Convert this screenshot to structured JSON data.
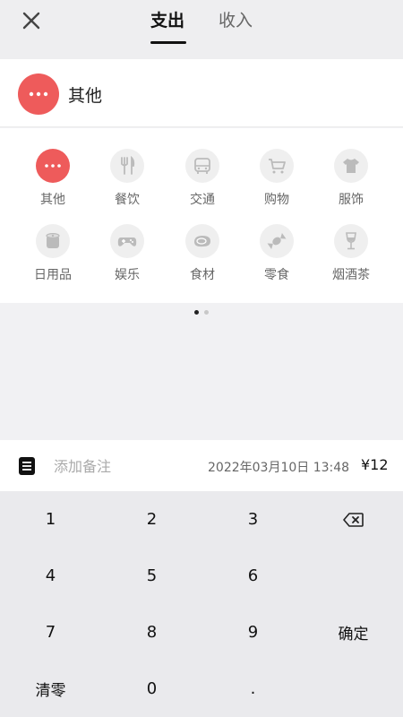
{
  "header": {
    "tabs": [
      {
        "label": "支出",
        "active": true
      },
      {
        "label": "收入",
        "active": false
      }
    ]
  },
  "selected": {
    "label": "其他",
    "color": "#ee5b5b"
  },
  "categories": [
    {
      "label": "其他",
      "icon": "more-icon",
      "active": true
    },
    {
      "label": "餐饮",
      "icon": "fork-knife-icon"
    },
    {
      "label": "交通",
      "icon": "bus-icon"
    },
    {
      "label": "购物",
      "icon": "shopping-cart-icon"
    },
    {
      "label": "服饰",
      "icon": "tshirt-icon"
    },
    {
      "label": "日用品",
      "icon": "tissue-roll-icon"
    },
    {
      "label": "娱乐",
      "icon": "gamepad-icon"
    },
    {
      "label": "食材",
      "icon": "meat-icon"
    },
    {
      "label": "零食",
      "icon": "candy-icon"
    },
    {
      "label": "烟酒茶",
      "icon": "wine-glass-icon"
    }
  ],
  "pager": {
    "current": 1,
    "total": 2
  },
  "note": {
    "placeholder": "添加备注",
    "date": "2022年03月10日 13:48",
    "amount": "¥12"
  },
  "keypad": {
    "k1": "1",
    "k2": "2",
    "k3": "3",
    "k4": "4",
    "k5": "5",
    "k6": "6",
    "k7": "7",
    "k8": "8",
    "k9": "9",
    "confirm": "确定",
    "clear": "清零",
    "k0": "0",
    "dot": "."
  }
}
